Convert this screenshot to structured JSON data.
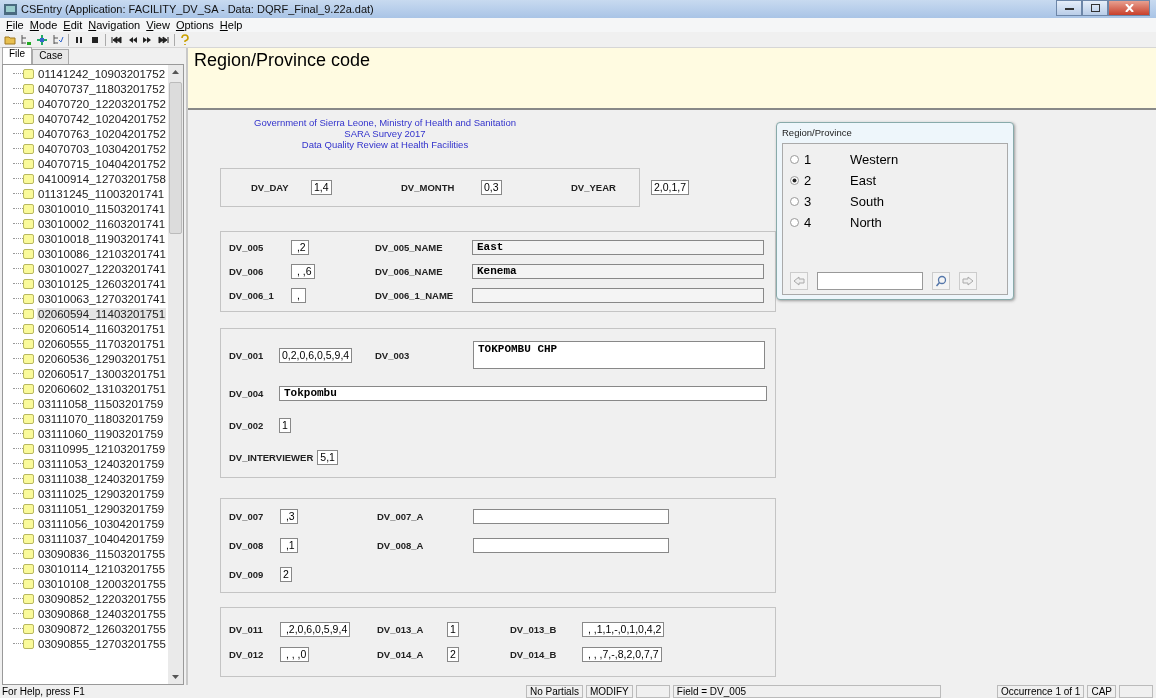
{
  "window": {
    "title": "CSEntry (Application: FACILITY_DV_SA - Data: DQRF_Final_9.22a.dat)"
  },
  "menu": [
    "File",
    "Mode",
    "Edit",
    "Navigation",
    "View",
    "Options",
    "Help"
  ],
  "sidebar": {
    "tabs": [
      {
        "label": "File",
        "selected": true
      },
      {
        "label": "Case",
        "selected": false
      }
    ],
    "items": [
      {
        "label": "01141242_10903201752",
        "selected": false
      },
      {
        "label": "04070737_11803201752",
        "selected": false
      },
      {
        "label": "04070720_12203201752",
        "selected": false
      },
      {
        "label": "04070742_10204201752",
        "selected": false
      },
      {
        "label": "04070763_10204201752",
        "selected": false
      },
      {
        "label": "04070703_10304201752",
        "selected": false
      },
      {
        "label": "04070715_10404201752",
        "selected": false
      },
      {
        "label": "04100914_12703201758",
        "selected": false
      },
      {
        "label": "01131245_11003201741",
        "selected": false
      },
      {
        "label": "03010010_11503201741",
        "selected": false
      },
      {
        "label": "03010002_11603201741",
        "selected": false
      },
      {
        "label": "03010018_11903201741",
        "selected": false
      },
      {
        "label": "03010086_12103201741",
        "selected": false
      },
      {
        "label": "03010027_12203201741",
        "selected": false
      },
      {
        "label": "03010125_12603201741",
        "selected": false
      },
      {
        "label": "03010063_12703201741",
        "selected": false
      },
      {
        "label": "02060594_11403201751",
        "selected": true
      },
      {
        "label": "02060514_11603201751",
        "selected": false
      },
      {
        "label": "02060555_11703201751",
        "selected": false
      },
      {
        "label": "02060536_12903201751",
        "selected": false
      },
      {
        "label": "02060517_13003201751",
        "selected": false
      },
      {
        "label": "02060602_13103201751",
        "selected": false
      },
      {
        "label": "03111058_11503201759",
        "selected": false
      },
      {
        "label": "03111070_11803201759",
        "selected": false
      },
      {
        "label": "03111060_11903201759",
        "selected": false
      },
      {
        "label": "03110995_12103201759",
        "selected": false
      },
      {
        "label": "03111053_12403201759",
        "selected": false
      },
      {
        "label": "03111038_12403201759",
        "selected": false
      },
      {
        "label": "03111025_12903201759",
        "selected": false
      },
      {
        "label": "03111051_12903201759",
        "selected": false
      },
      {
        "label": "03111056_10304201759",
        "selected": false
      },
      {
        "label": "03111037_10404201759",
        "selected": false
      },
      {
        "label": "03090836_11503201755",
        "selected": false
      },
      {
        "label": "03010114_12103201755",
        "selected": false
      },
      {
        "label": "03010108_12003201755",
        "selected": false
      },
      {
        "label": "03090852_12203201755",
        "selected": false
      },
      {
        "label": "03090868_12403201755",
        "selected": false
      },
      {
        "label": "03090872_12603201755",
        "selected": false
      },
      {
        "label": "03090855_12703201755",
        "selected": false
      }
    ]
  },
  "prompt": "Region/Province code",
  "form": {
    "header": [
      "Government of Sierra Leone, Ministry of Health and Sanitation",
      "SARA Survey 2017",
      "Data Quality Review at Health Facilities"
    ],
    "groups": [
      {
        "kind": "date",
        "rows": [
          [
            {
              "label": "DV_DAY",
              "value": "1,4",
              "kind": "digits"
            },
            {
              "label": "DV_MONTH",
              "value": "0,3",
              "kind": "digits"
            },
            {
              "label": "DV_YEAR",
              "value": "2,0,1,7",
              "kind": "digits"
            }
          ]
        ]
      },
      {
        "kind": "names",
        "rows": [
          [
            {
              "label": "DV_005",
              "value": " ,2",
              "kind": "digits"
            },
            {
              "label": "DV_005_NAME",
              "value": "East",
              "kind": "alpha"
            }
          ],
          [
            {
              "label": "DV_006",
              "value": " , ,6",
              "kind": "digits"
            },
            {
              "label": "DV_006_NAME",
              "value": "Kenema",
              "kind": "alpha"
            }
          ],
          [
            {
              "label": "DV_006_1",
              "value": " , ",
              "kind": "digits"
            },
            {
              "label": "DV_006_1_NAME",
              "kind": "alpha"
            }
          ]
        ]
      },
      {
        "kind": "facility",
        "rows": [
          [
            {
              "label": "DV_001",
              "value": "0,2,0,6,0,5,9,4",
              "kind": "digits"
            },
            {
              "label": "DV_003",
              "value": "TOKPOMBU CHP",
              "kind": "tall"
            }
          ],
          [
            {
              "label": "DV_004",
              "value": "Tokpombu",
              "kind": "wide"
            }
          ],
          [
            {
              "label": "DV_002",
              "value": "1",
              "kind": "digits"
            }
          ],
          [
            {
              "label": "DV_INTERVIEWER",
              "value": "5,1",
              "kind": "digits"
            }
          ]
        ]
      },
      {
        "kind": "other",
        "rows": [
          [
            {
              "label": "DV_007",
              "value": " ,3",
              "kind": "digits"
            },
            {
              "label": "DV_007_A",
              "kind": "white"
            }
          ],
          [
            {
              "label": "DV_008",
              "value": " ,1",
              "kind": "digits"
            },
            {
              "label": "DV_008_A",
              "kind": "white"
            }
          ],
          [
            {
              "label": "DV_009",
              "value": "2",
              "kind": "digits"
            }
          ]
        ]
      },
      {
        "kind": "codes",
        "rows": [
          [
            {
              "label": "DV_011",
              "value": " ,2,0,6,0,5,9,4",
              "kind": "digits"
            },
            {
              "label": "DV_013_A",
              "value": "1",
              "kind": "digits"
            },
            {
              "label": "DV_013_B",
              "value": " , ,1,1,-,0,1,0,4,2",
              "kind": "digits"
            }
          ],
          [
            {
              "label": "DV_012",
              "value": " , , ,0",
              "kind": "digits"
            },
            {
              "label": "DV_014_A",
              "value": "2",
              "kind": "digits"
            },
            {
              "label": "DV_014_B",
              "value": " , , ,7,-,8,2,0,7,7",
              "kind": "digits"
            }
          ]
        ]
      }
    ]
  },
  "popup": {
    "title": "Region/Province",
    "options": [
      {
        "code": "1",
        "label": "Western",
        "selected": false
      },
      {
        "code": "2",
        "label": "East",
        "selected": true
      },
      {
        "code": "3",
        "label": "South",
        "selected": false
      },
      {
        "code": "4",
        "label": "North",
        "selected": false
      }
    ]
  },
  "status_bar": {
    "help": "For Help, press F1",
    "panels": [
      {
        "kind": "text",
        "text": "No Partials"
      },
      {
        "kind": "text",
        "text": "MODIFY"
      },
      {
        "kind": "blank"
      },
      {
        "kind": "text",
        "text": "Field = DV_005"
      },
      {
        "kind": "text",
        "text": "Occurrence 1 of 1"
      },
      {
        "kind": "text",
        "text": "CAP"
      },
      {
        "kind": "blank"
      }
    ]
  }
}
